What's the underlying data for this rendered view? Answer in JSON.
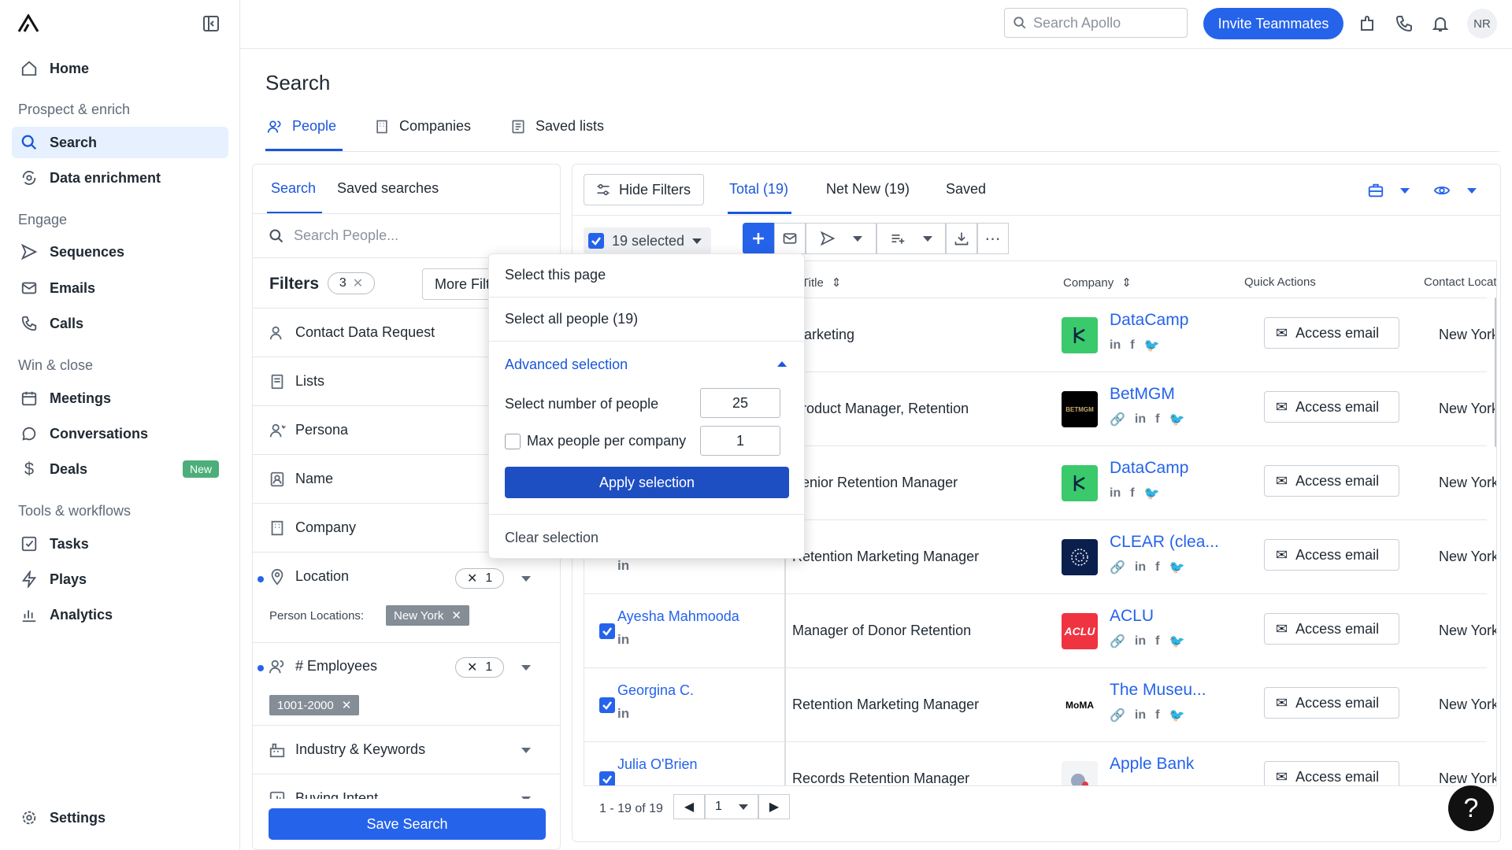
{
  "sidebar": {
    "home": "Home",
    "section_prospect": "Prospect & enrich",
    "search": "Search",
    "data_enrichment": "Data enrichment",
    "section_engage": "Engage",
    "sequences": "Sequences",
    "emails": "Emails",
    "calls": "Calls",
    "section_win": "Win & close",
    "meetings": "Meetings",
    "conversations": "Conversations",
    "deals": "Deals",
    "deals_badge": "New",
    "section_tools": "Tools & workflows",
    "tasks": "Tasks",
    "plays": "Plays",
    "analytics": "Analytics",
    "settings": "Settings"
  },
  "topbar": {
    "search_placeholder": "Search Apollo",
    "invite": "Invite Teammates",
    "avatar": "NR"
  },
  "page": {
    "title": "Search",
    "tabs": [
      "People",
      "Companies",
      "Saved lists"
    ]
  },
  "filters": {
    "tab_search": "Search",
    "tab_saved": "Saved searches",
    "search_placeholder": "Search People...",
    "title": "Filters",
    "count": "3",
    "more": "More Filters",
    "rows": {
      "contact": "Contact Data Request",
      "lists": "Lists",
      "persona": "Persona",
      "name": "Name",
      "company": "Company",
      "location": "Location",
      "employees": "# Employees",
      "industry": "Industry & Keywords",
      "intent": "Buying Intent"
    },
    "location_count": "1",
    "location_sublabel": "Person Locations:",
    "location_chip": "New York",
    "employees_count": "1",
    "employees_chip": "1001-2000",
    "save": "Save Search"
  },
  "results": {
    "hide_filters": "Hide Filters",
    "tabs": [
      "Total (19)",
      "Net New (19)",
      "Saved"
    ],
    "selected": "19 selected",
    "columns": {
      "title": "Title",
      "company": "Company",
      "actions": "Quick Actions",
      "location": "Contact Location"
    },
    "access_label": "Access email",
    "rows": [
      {
        "name": "",
        "title": "Marketing",
        "company": "DataCamp",
        "location": "New York"
      },
      {
        "name": "",
        "title": "Product Manager, Retention",
        "company": "BetMGM",
        "location": "New York"
      },
      {
        "name": "",
        "title": "Senior Retention Manager",
        "company": "DataCamp",
        "location": "New York"
      },
      {
        "name": "",
        "title": "Retention Marketing Manager",
        "company": "CLEAR (clea...",
        "location": "New York"
      },
      {
        "name": "Ayesha Mahmooda",
        "title": "Manager of Donor Retention",
        "company": "ACLU",
        "location": "New York"
      },
      {
        "name": "Georgina C.",
        "title": "Retention Marketing Manager",
        "company": "The Museu...",
        "location": "New York"
      },
      {
        "name": "Julia O'Brien",
        "title": "Records Retention Manager",
        "company": "Apple Bank",
        "location": "New York"
      }
    ],
    "logos": {
      "betmgm": "BETMGM",
      "aclu": "ACLU",
      "moma": "MoMA"
    },
    "pager_text": "1 - 19 of 19",
    "page": "1"
  },
  "dropdown": {
    "select_page": "Select this page",
    "select_all": "Select all people (19)",
    "advanced": "Advanced selection",
    "num_label": "Select number of people",
    "num_value": "25",
    "max_label": "Max people per company",
    "max_value": "1",
    "apply": "Apply selection",
    "clear": "Clear selection"
  },
  "help": "?",
  "colors": {
    "accent": "#2563eb",
    "apply": "#1e4fc2",
    "active_nav_bg": "#e6f0ff"
  }
}
